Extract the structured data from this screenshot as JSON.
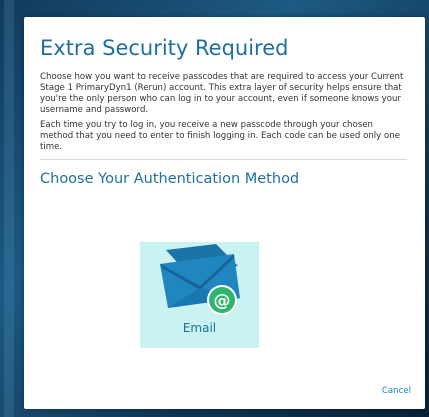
{
  "dialog": {
    "title": "Extra Security Required",
    "paragraph_1": "Choose how you want to receive passcodes that are required to access your Current Stage 1 PrimaryDyn1 (Rerun) account. This extra layer of security helps ensure that you're the only person who can log in to your account, even if someone knows your username and password.",
    "paragraph_2": "Each time you try to log in, you receive a new passcode through your chosen method that you need to enter to finish logging in. Each code can be used only one time.",
    "section_title": "Choose Your Authentication Method",
    "methods": [
      {
        "label": "Email",
        "icon": "envelope-at-icon"
      }
    ],
    "cancel_label": "Cancel"
  },
  "colors": {
    "accent": "#1f6f9e",
    "card_background": "#c9f2f0",
    "envelope": "#1a74a8",
    "badge": "#2fb56b",
    "link": "#1f7fbf"
  }
}
